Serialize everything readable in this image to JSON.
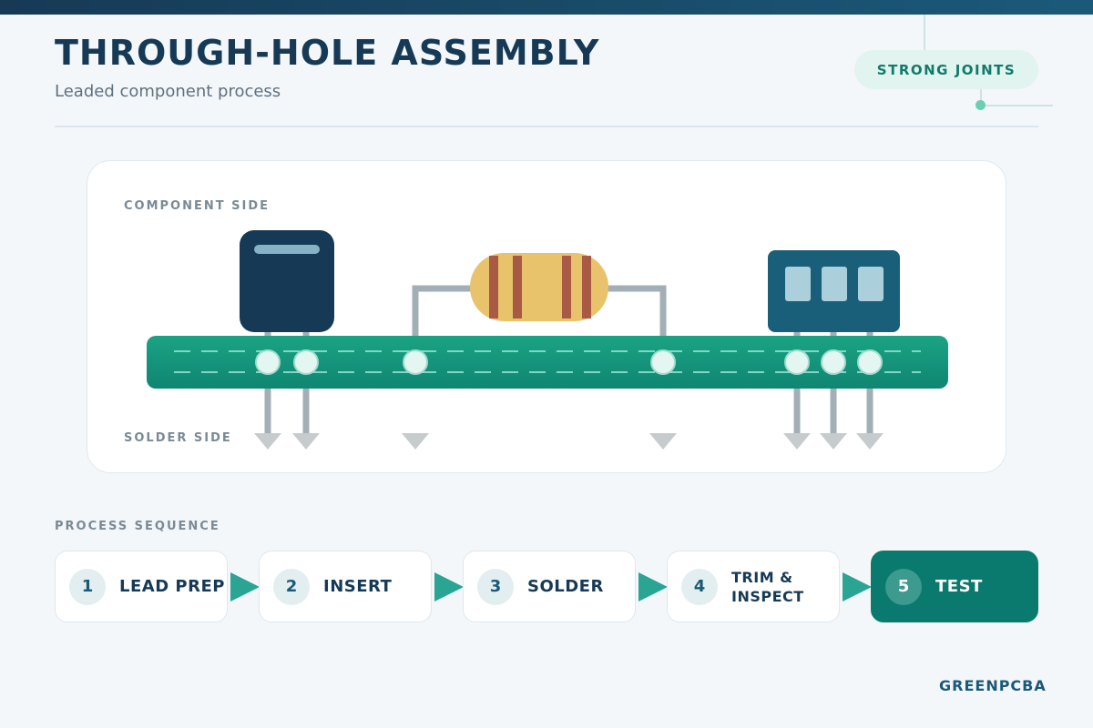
{
  "header": {
    "title": "THROUGH-HOLE ASSEMBLY",
    "subtitle": "Leaded component process",
    "badge": "STRONG JOINTS"
  },
  "diagram": {
    "component_side_label": "COMPONENT SIDE",
    "solder_side_label": "SOLDER SIDE"
  },
  "process": {
    "section_label": "PROCESS SEQUENCE",
    "steps": [
      {
        "number": "1",
        "label": "LEAD PREP"
      },
      {
        "number": "2",
        "label": "INSERT"
      },
      {
        "number": "3",
        "label": "SOLDER"
      },
      {
        "number": "4",
        "label": "TRIM & INSPECT"
      },
      {
        "number": "5",
        "label": "TEST"
      }
    ]
  },
  "footer": {
    "brand": "GREENPCBA"
  },
  "colors": {
    "navy": "#163a56",
    "teal": "#0b7a6e",
    "board_green": "#179a7f",
    "resistor_body": "#e8c36c",
    "resistor_band": "#a85a44",
    "lead_gray": "#a2afb6"
  }
}
